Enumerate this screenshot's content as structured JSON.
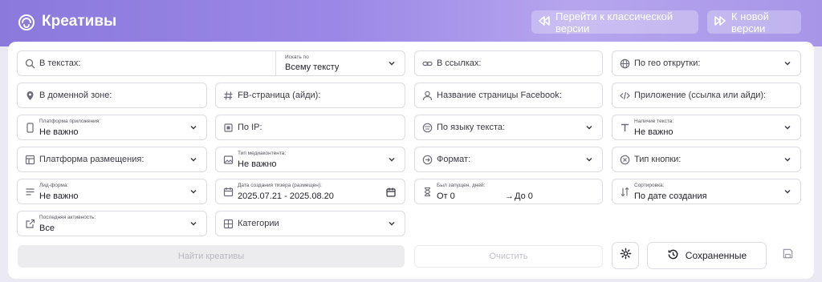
{
  "header": {
    "title": "Креативы",
    "classic_btn": "Перейти к классической версии",
    "new_btn": "К новой версии"
  },
  "fields": {
    "search_texts": "В текстах:",
    "search_by_label": "Искать по",
    "search_by_value": "Всему тексту",
    "links": "В ссылках:",
    "geo": "По гео открутки:",
    "domain_zone": "В доменной зоне:",
    "fb_page": "FB-страница (айди):",
    "fb_page_name": "Название страницы Facebook:",
    "app": "Приложение (ссылка или айди):",
    "app_platform_label": "Платформа приложения:",
    "app_platform_value": "Не важно",
    "ip": "По IP:",
    "text_lang": "По языку текста:",
    "has_text_label": "Наличие текста:",
    "has_text_value": "Не важно",
    "placement": "Платформа размещения:",
    "media_type_label": "Тип медиаконтента:",
    "media_type_value": "Не важно",
    "format": "Формат:",
    "button_type": "Тип кнопки:",
    "lead_form_label": "Лид-форма:",
    "lead_form_value": "Не важно",
    "created_label": "Дата создания тизера (размещен):",
    "created_value": "2025.07.21 - 2025.08.20",
    "running_label": "Был запущен, дней:",
    "running_from": "От 0",
    "running_to": "До 0",
    "sort_label": "Сортировка:",
    "sort_value": "По дате создания",
    "last_activity_label": "Последняя активность:",
    "last_activity_value": "Все",
    "categories": "Категории"
  },
  "actions": {
    "find": "Найти креативы",
    "clear": "Очистить",
    "saved": "Сохраненные"
  },
  "colors": {
    "header_accent": "#9a87e6",
    "disabled_text": "#b8b8c0"
  }
}
